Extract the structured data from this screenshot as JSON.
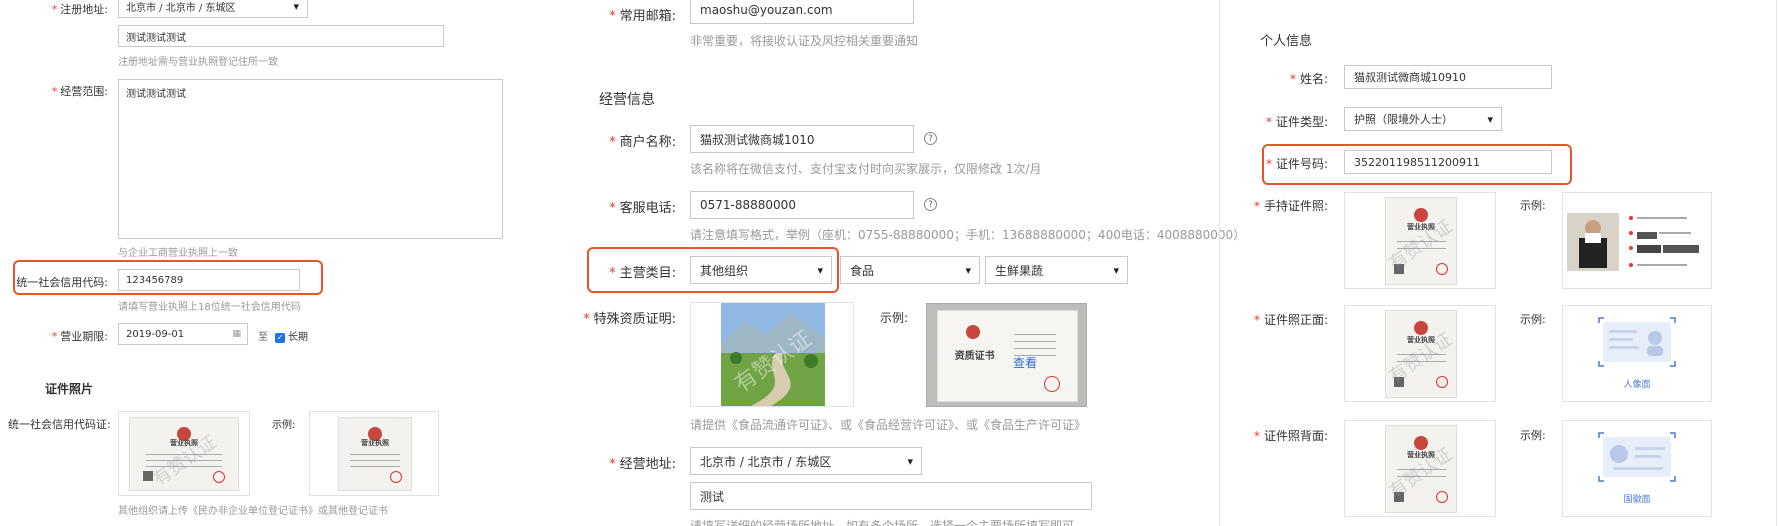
{
  "left": {
    "reg_address": {
      "label": "注册地址:",
      "select_value": "北京市 / 北京市 / 东城区",
      "detail_value": "测试测试测试",
      "hint": "注册地址需与营业执照登记住所一致"
    },
    "scope": {
      "label": "经营范围:",
      "value": "测试测试测试",
      "hint": "与企业工商营业执照上一致"
    },
    "credit_code": {
      "label": "统一社会信用代码:",
      "value": "123456789",
      "hint": "请填写营业执照上18位统一社会信用代码"
    },
    "period": {
      "label": "营业期限:",
      "date": "2019-09-01",
      "to": "至",
      "long_term": "长期"
    },
    "photos": {
      "title": "证件照片",
      "cert_label": "统一社会信用代码证:",
      "sample_label": "示例:",
      "cert_title": "营业执照",
      "hint": "其他组织请上传《民办非企业单位登记证书》或其他登记证书"
    }
  },
  "middle": {
    "email": {
      "label": "常用邮箱:",
      "value": "maoshu@youzan.com",
      "hint": "非常重要，将接收认证及风控相关重要通知"
    },
    "section_title": "经营信息",
    "merchant_name": {
      "label": "商户名称:",
      "value": "猫叔测试微商城1010",
      "hint": "该名称将在微信支付、支付宝支付时向买家展示，仅限修改 1次/月"
    },
    "service_phone": {
      "label": "客服电话:",
      "value": "0571-88880000",
      "hint": "请注意填写格式，举例（座机：0755-88880000；手机：13688880000；400电话：4008880000）"
    },
    "category": {
      "label": "主营类目:",
      "values": [
        "其他组织",
        "食品",
        "生鲜果蔬"
      ]
    },
    "qualification": {
      "label": "特殊资质证明:",
      "sample_label": "示例:",
      "cert_title": "资质证书",
      "view_link": "查看",
      "hint": "请提供《食品流通许可证》、或《食品经营许可证》、或《食品生产许可证》"
    },
    "biz_address": {
      "label": "经营地址:",
      "select_value": "北京市 / 北京市 / 东城区",
      "detail_value": "测试",
      "hint": "请填写详细的经营场所地址，如有多个场所，选择一个主要场所填写即可"
    }
  },
  "right": {
    "section_title": "个人信息",
    "name": {
      "label": "姓名:",
      "value": "猫叔测试微商城10910"
    },
    "id_type": {
      "label": "证件类型:",
      "value": "护照（限境外人士）"
    },
    "id_number": {
      "label": "证件号码:",
      "value": "352201198511200911"
    },
    "handheld": {
      "label": "手持证件照:",
      "sample_label": "示例:"
    },
    "front": {
      "label": "证件照正面:",
      "sample_label": "示例:",
      "caption": "人像面"
    },
    "back": {
      "label": "证件照背面:",
      "sample_label": "示例:",
      "caption": "国徽面"
    }
  },
  "watermark_text": "有赞认证",
  "cert_header": "营业执照"
}
